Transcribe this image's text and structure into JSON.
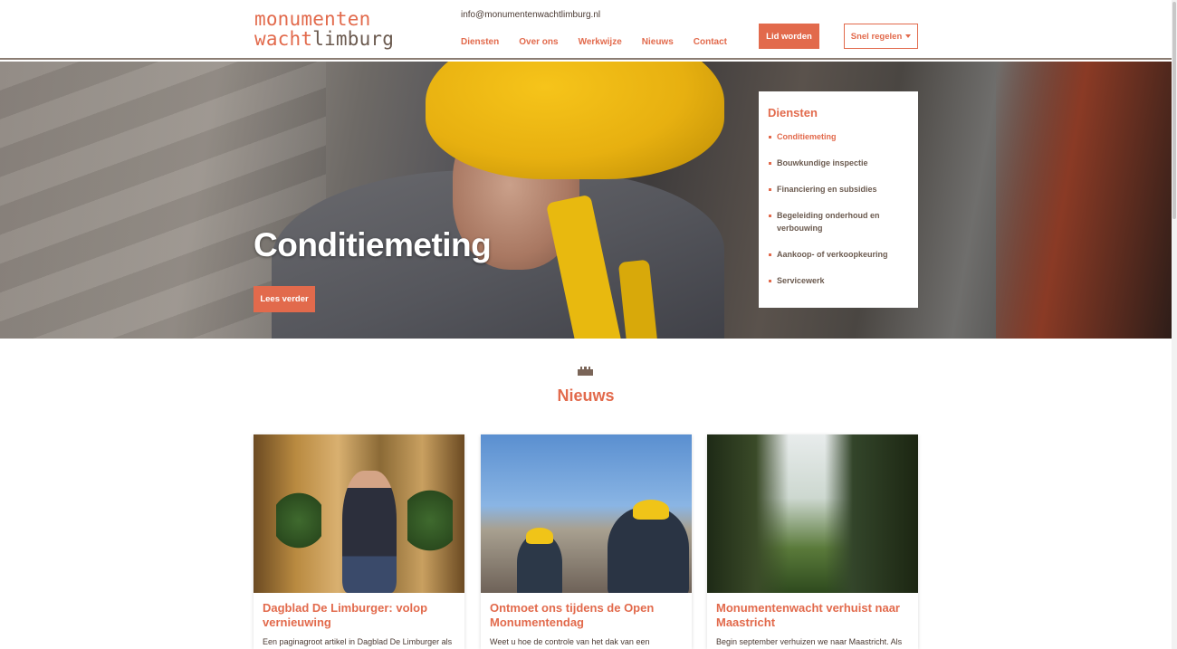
{
  "header": {
    "logo_line1": "monumenten",
    "logo_line2a": "wacht",
    "logo_line2b": "limburg",
    "email": "info@monumentenwachtlimburg.nl",
    "nav": [
      "Diensten",
      "Over ons",
      "Werkwijze",
      "Nieuws",
      "Contact"
    ],
    "join_label": "Lid worden",
    "quick_label": "Snel regelen"
  },
  "hero": {
    "title": "Conditiemeting",
    "button_label": "Lees verder"
  },
  "services": {
    "title": "Diensten",
    "items": [
      "Conditiemeting",
      "Bouwkundige inspectie",
      "Financiering en subsidies",
      "Begeleiding onderhoud en verbouwing",
      "Aankoop- of verkoopkeuring",
      "Servicewerk"
    ],
    "active_index": 0
  },
  "news": {
    "title": "Nieuws",
    "cards": [
      {
        "title": "Dagblad De Limburger: volop vernieuwing",
        "excerpt": "Een paginagroot artikel in Dagblad De Limburger als"
      },
      {
        "title": "Ontmoet ons tijdens de Open Monumentendag",
        "excerpt": "Weet u hoe de controle van het dak van een"
      },
      {
        "title": "Monumentenwacht verhuist naar Maastricht",
        "excerpt": "Begin september verhuizen we naar Maastricht. Als"
      }
    ]
  },
  "colors": {
    "accent": "#e26a4c",
    "text": "#4a3a33",
    "muted": "#6b5a4f"
  }
}
